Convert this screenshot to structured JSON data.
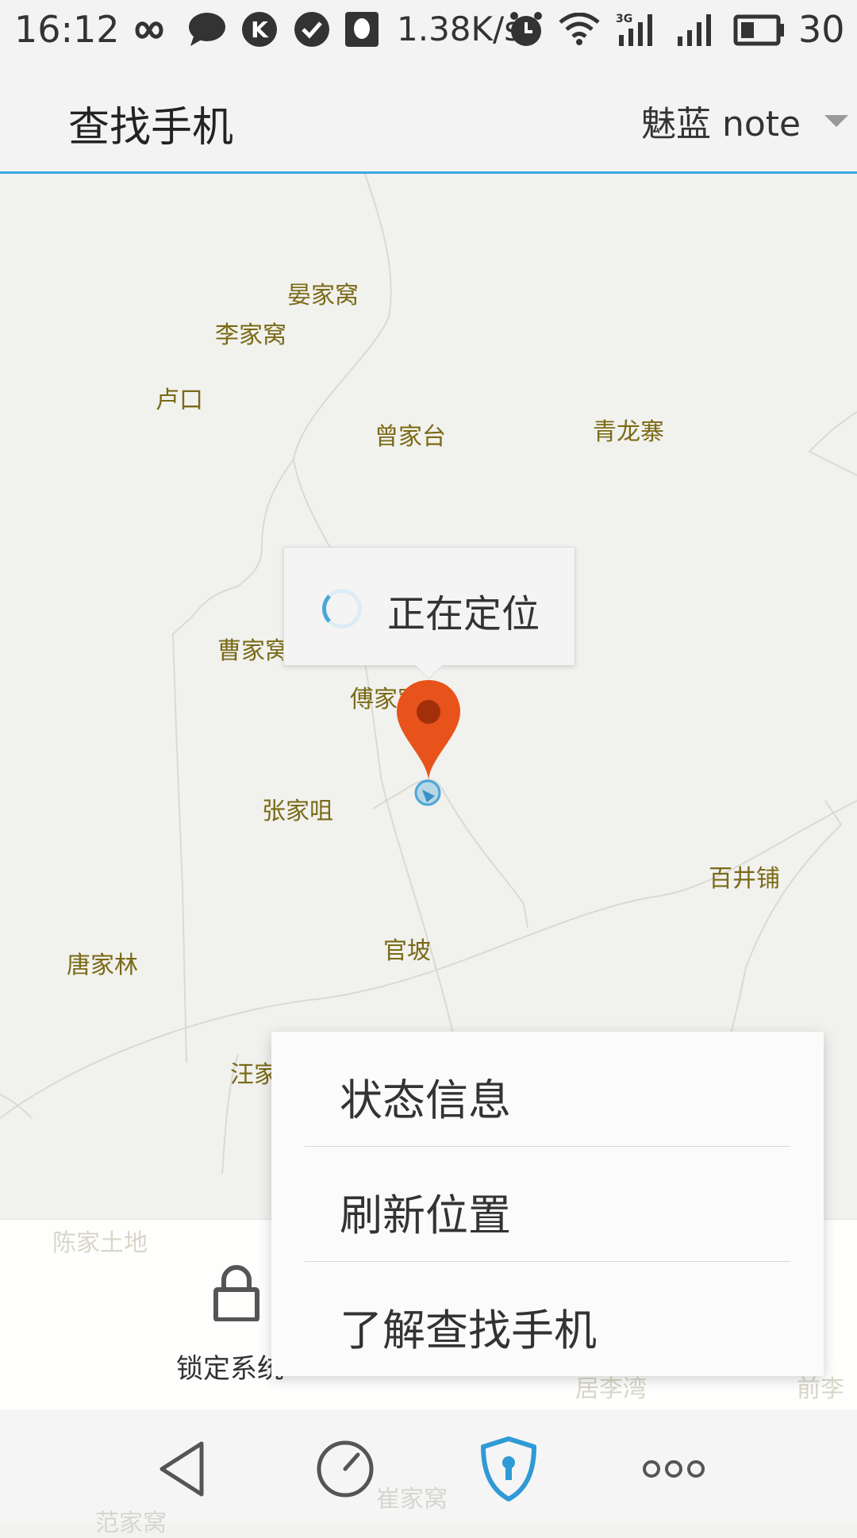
{
  "status_bar": {
    "time": "16:12",
    "network_speed": "1.38K/s",
    "network_type": "3G",
    "battery": "30",
    "icons": [
      "infinity-icon",
      "chat-bubble-icon",
      "k-icon",
      "check-icon",
      "qq-icon",
      "alarm-icon",
      "wifi-icon",
      "signal-3g-icon",
      "signal-icon",
      "battery-icon"
    ]
  },
  "app_bar": {
    "title": "查找手机",
    "device_name": "魅蓝 note"
  },
  "map": {
    "places": [
      "晏家窝",
      "李家窝",
      "卢口",
      "曾家台",
      "青龙寨",
      "曹家窝",
      "傅家窝",
      "张家咀",
      "百井铺",
      "官坡",
      "唐家林",
      "汪家"
    ],
    "faded_places": [
      "陈家土地",
      "崔家窝",
      "范家窝",
      "居李湾",
      "前李"
    ],
    "locating_text": "正在定位",
    "colors": {
      "marker": "#e8531b",
      "accent": "#3aa6dd",
      "place_label": "#7a6a16"
    }
  },
  "action_bar": {
    "lock_label": "锁定系统"
  },
  "popup_menu": {
    "items": [
      {
        "label": "状态信息"
      },
      {
        "label": "刷新位置"
      },
      {
        "label": "了解查找手机"
      }
    ]
  },
  "nav_bar": {
    "buttons": [
      "back-triangle-icon",
      "gauge-icon",
      "shield-keyhole-icon",
      "more-dots-icon"
    ],
    "active": "shield-keyhole-icon"
  }
}
